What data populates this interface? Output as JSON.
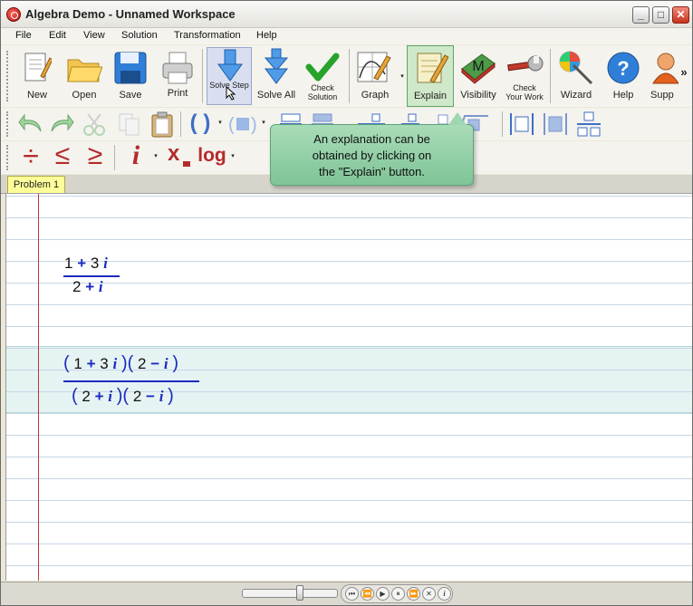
{
  "window": {
    "title": "Algebra Demo - Unnamed Workspace"
  },
  "window_buttons": {
    "minimize": "_",
    "maximize": "□",
    "close": "✕"
  },
  "menu": [
    "File",
    "Edit",
    "View",
    "Solution",
    "Transformation",
    "Help"
  ],
  "toolbar1": {
    "new": "New",
    "open": "Open",
    "save": "Save",
    "print": "Print",
    "solve_step": "Solve Step",
    "solve_all": "Solve All",
    "check_solution_1": "Check",
    "check_solution_2": "Solution",
    "graph": "Graph",
    "explain": "Explain",
    "visibility": "Visibility",
    "check_work_1": "Check",
    "check_work_2": "Your Work",
    "wizard": "Wizard",
    "help": "Help",
    "support": "Supp",
    "overflow": "»",
    "visibility_letter": "M"
  },
  "toolbar3": {
    "divide": "÷",
    "le": "≤",
    "ge": "≥",
    "imag": "i",
    "subscript_x": "x",
    "log": "log"
  },
  "tooltip": {
    "line1": "An explanation can be",
    "line2": "obtained by clicking on",
    "line3": "the \"Explain\" button."
  },
  "tabs": [
    "Problem 1"
  ],
  "expressions": {
    "expr1": {
      "num_a": "1",
      "num_op": "+",
      "num_b": "3",
      "num_v": "i",
      "den_a": "2",
      "den_op": "+",
      "den_v": "i"
    },
    "expr2": {
      "num": {
        "p1": "(",
        "a": "1",
        "op": "+",
        "b": "3",
        "v": "i",
        "p2": ")",
        "p3": "(",
        "c": "2",
        "op2": "−",
        "v2": "i",
        "p4": ")"
      },
      "den": {
        "p1": "(",
        "a": "2",
        "op": "+",
        "v": "i",
        "p2": ")",
        "p3": "(",
        "c": "2",
        "op2": "−",
        "v2": "i",
        "p4": ")"
      }
    }
  },
  "player": {
    "first": "⏮",
    "prev": "⏪",
    "play": "▶",
    "pause": "⏸",
    "next": "⏩",
    "stop": "✕",
    "info": "i"
  },
  "colors": {
    "accent": "#1a2bbf",
    "tooltip_bg": "#8fcfa4",
    "margin_line": "#c0392b",
    "tab_bg": "#ffff99"
  }
}
